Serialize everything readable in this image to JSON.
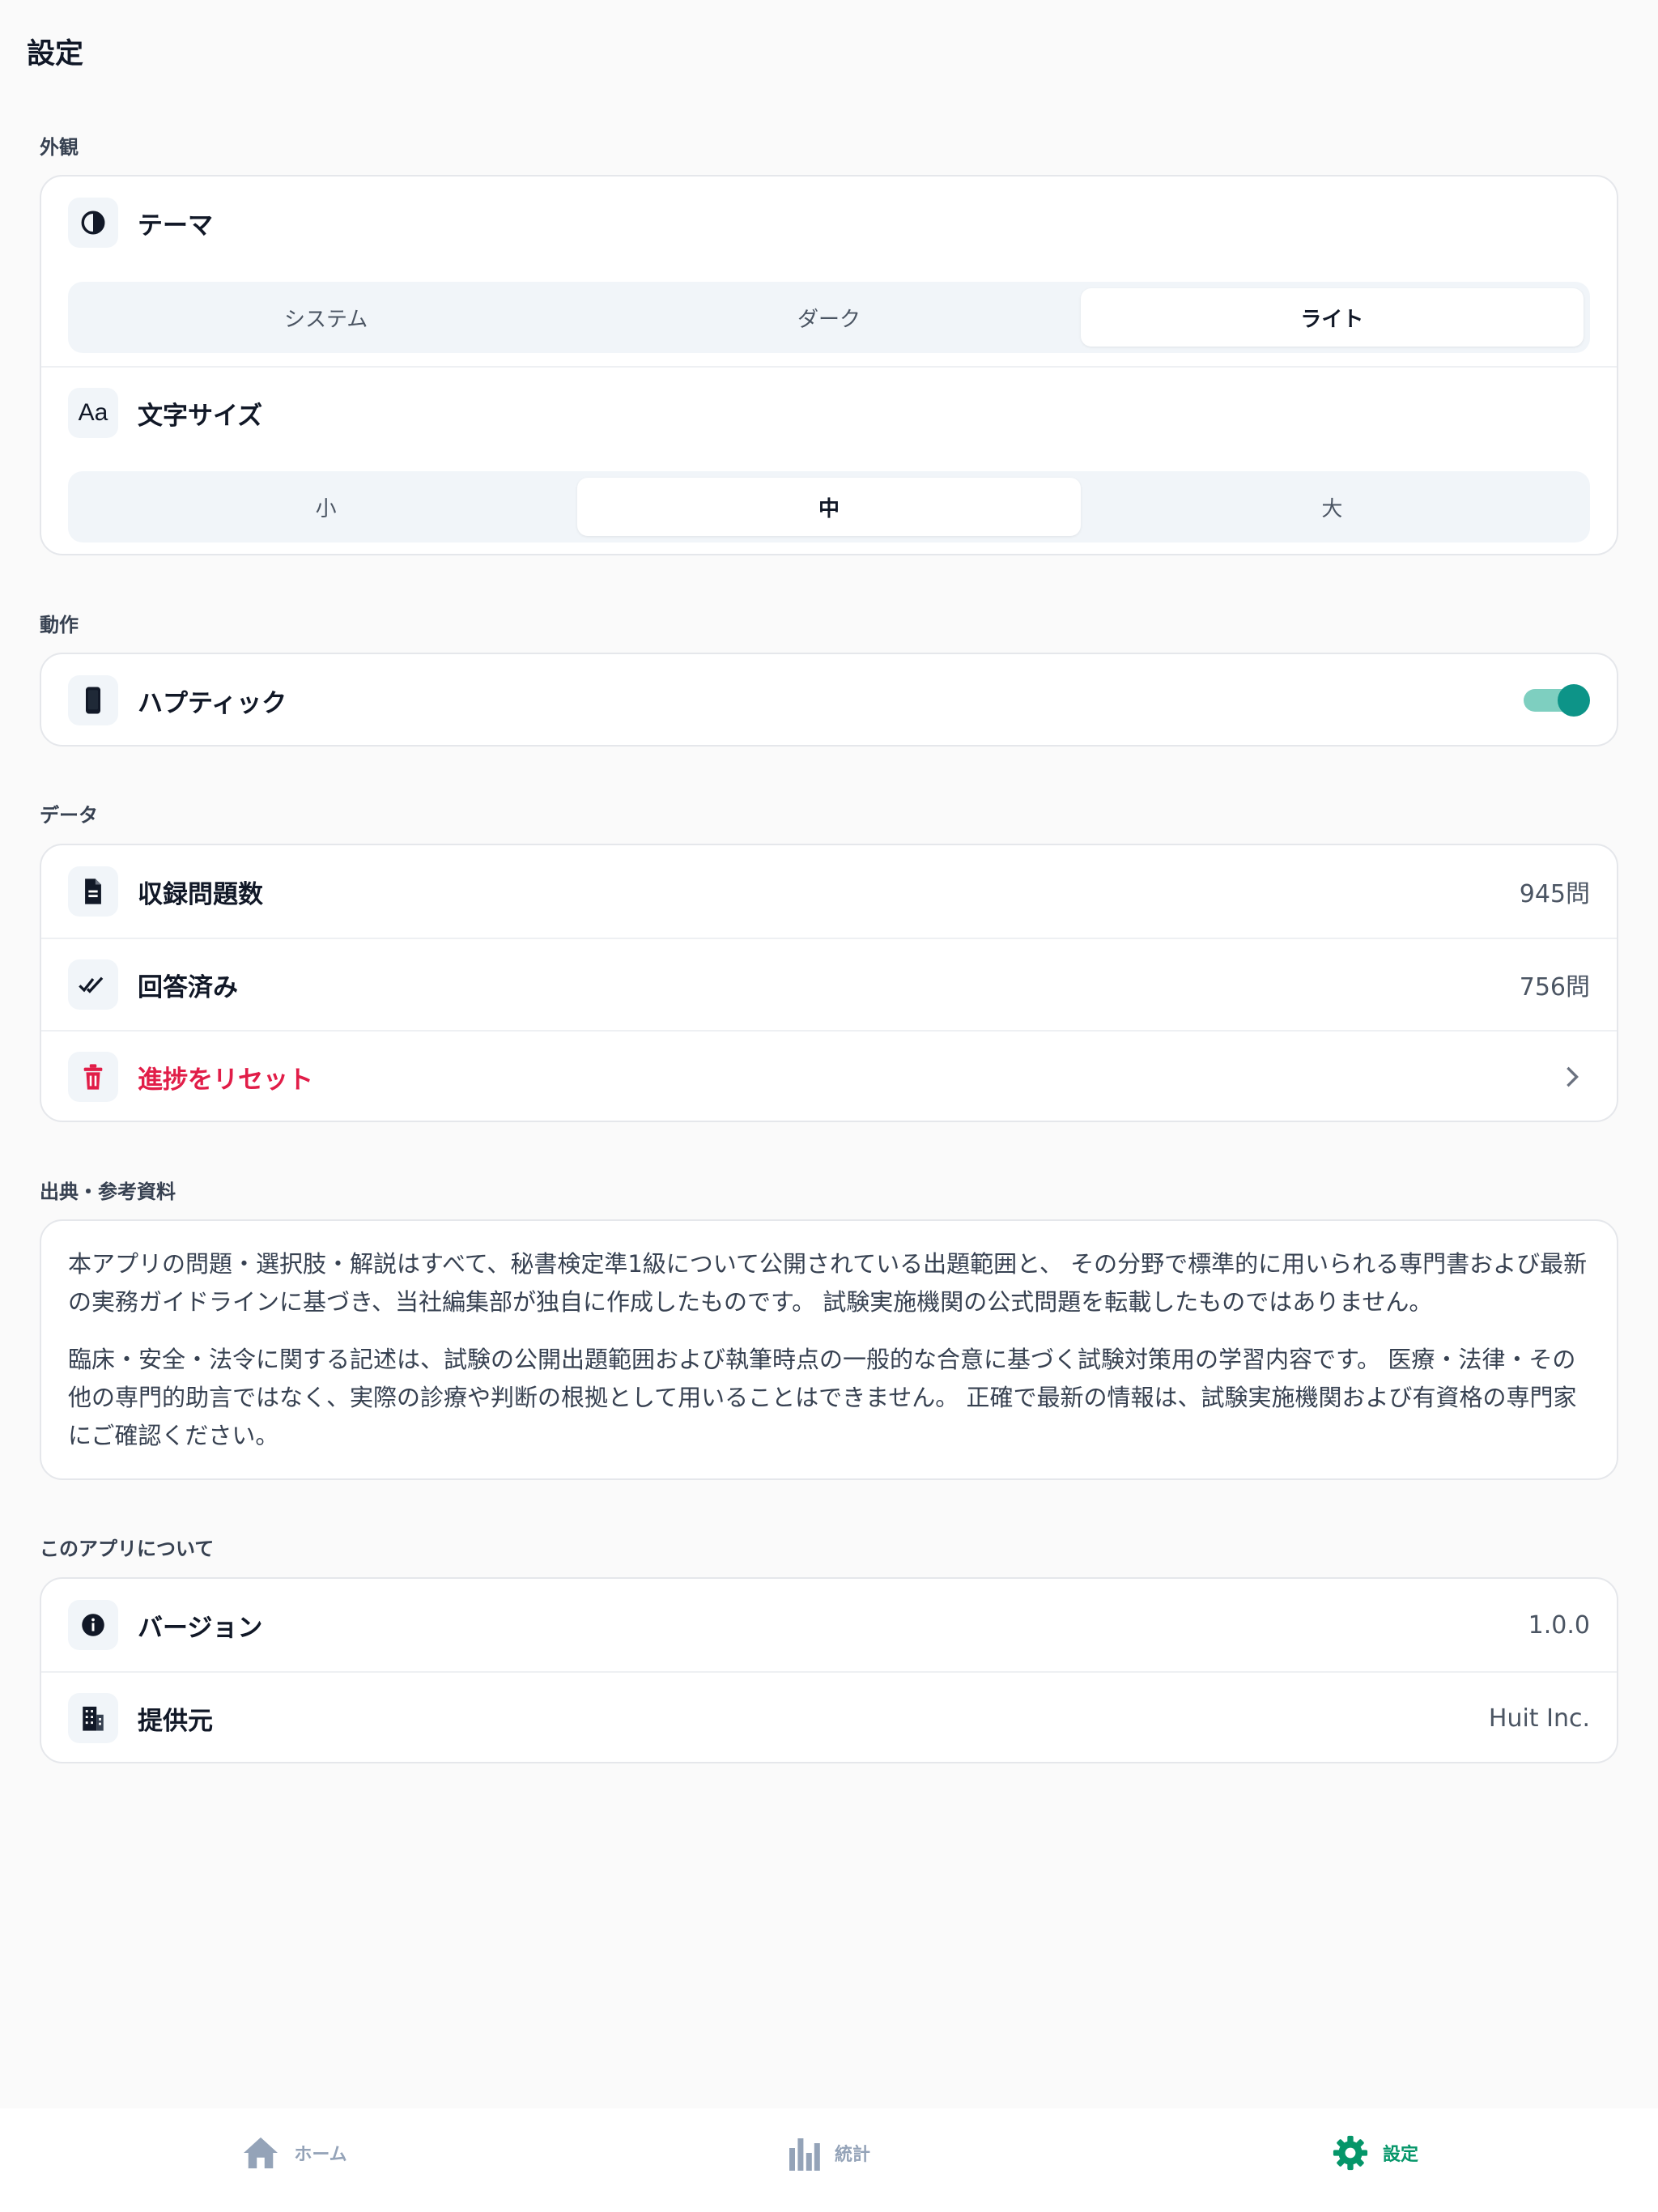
{
  "page": {
    "title": "設定"
  },
  "appearance": {
    "section_label": "外観",
    "theme": {
      "icon": "contrast-icon",
      "label": "テーマ",
      "options": [
        "システム",
        "ダーク",
        "ライト"
      ],
      "selected": "ライト"
    },
    "font_size": {
      "icon": "font-size-icon",
      "icon_text": "Aa",
      "label": "文字サイズ",
      "options": [
        "小",
        "中",
        "大"
      ],
      "selected": "中"
    }
  },
  "behavior": {
    "section_label": "動作",
    "haptics": {
      "icon": "phone-icon",
      "label": "ハプティック",
      "enabled": true
    }
  },
  "data_section": {
    "section_label": "データ",
    "question_count": {
      "icon": "document-icon",
      "label": "収録問題数",
      "value": "945問"
    },
    "answered": {
      "icon": "double-check-icon",
      "label": "回答済み",
      "value": "756問"
    },
    "reset": {
      "icon": "trash-icon",
      "label": "進捗をリセット"
    }
  },
  "sources": {
    "section_label": "出典・参考資料",
    "paragraph1": "本アプリの問題・選択肢・解説はすべて、秘書検定準1級について公開されている出題範囲と、 その分野で標準的に用いられる専門書および最新の実務ガイドラインに基づき、当社編集部が独自に作成したものです。 試験実施機関の公式問題を転載したものではありません。",
    "paragraph2": "臨床・安全・法令に関する記述は、試験の公開出題範囲および執筆時点の一般的な合意に基づく試験対策用の学習内容です。 医療・法律・その他の専門的助言ではなく、実際の診療や判断の根拠として用いることはできません。 正確で最新の情報は、試験実施機関および有資格の専門家にご確認ください。"
  },
  "about": {
    "section_label": "このアプリについて",
    "version": {
      "icon": "info-icon",
      "label": "バージョン",
      "value": "1.0.0"
    },
    "provider": {
      "icon": "building-icon",
      "label": "提供元",
      "value": "Huit Inc."
    }
  },
  "tabbar": {
    "tabs": [
      {
        "icon": "home-icon",
        "label": "ホーム",
        "active": false
      },
      {
        "icon": "bar-chart-icon",
        "label": "統計",
        "active": false
      },
      {
        "icon": "gear-icon",
        "label": "設定",
        "active": true
      }
    ]
  },
  "colors": {
    "accent": "#059669",
    "toggle_on": "#0d9488",
    "danger": "#e11d48"
  }
}
